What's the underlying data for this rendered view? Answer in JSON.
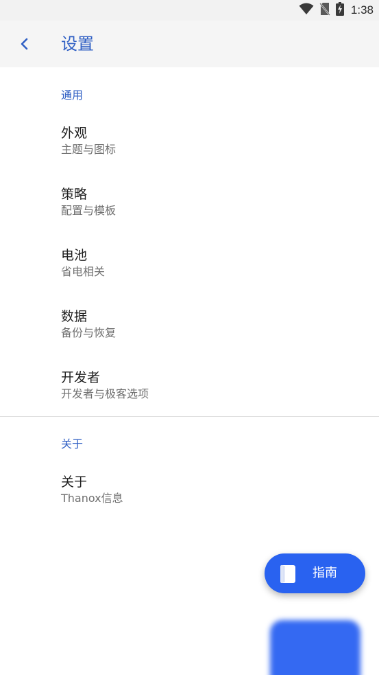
{
  "status_bar": {
    "time": "1:38",
    "icons": [
      "wifi-icon",
      "no-sim-icon",
      "battery-charging-icon"
    ]
  },
  "app_bar": {
    "back_icon": "chevron-left-icon",
    "title": "设置"
  },
  "sections": [
    {
      "header": "通用",
      "items": [
        {
          "title": "外观",
          "summary": "主题与图标"
        },
        {
          "title": "策略",
          "summary": "配置与模板"
        },
        {
          "title": "电池",
          "summary": "省电相关"
        },
        {
          "title": "数据",
          "summary": "备份与恢复"
        },
        {
          "title": "开发者",
          "summary": "开发者与极客选项"
        }
      ]
    },
    {
      "header": "关于",
      "items": [
        {
          "title": "关于",
          "summary": "Thanox信息"
        }
      ]
    }
  ],
  "fab": {
    "icon": "book-icon",
    "label": "指南"
  },
  "colors": {
    "accent": "#2f5fc4",
    "fab": "#2962f0",
    "app_bar_bg": "#f5f5f5",
    "status_bar_bg": "#f2f2f2"
  }
}
